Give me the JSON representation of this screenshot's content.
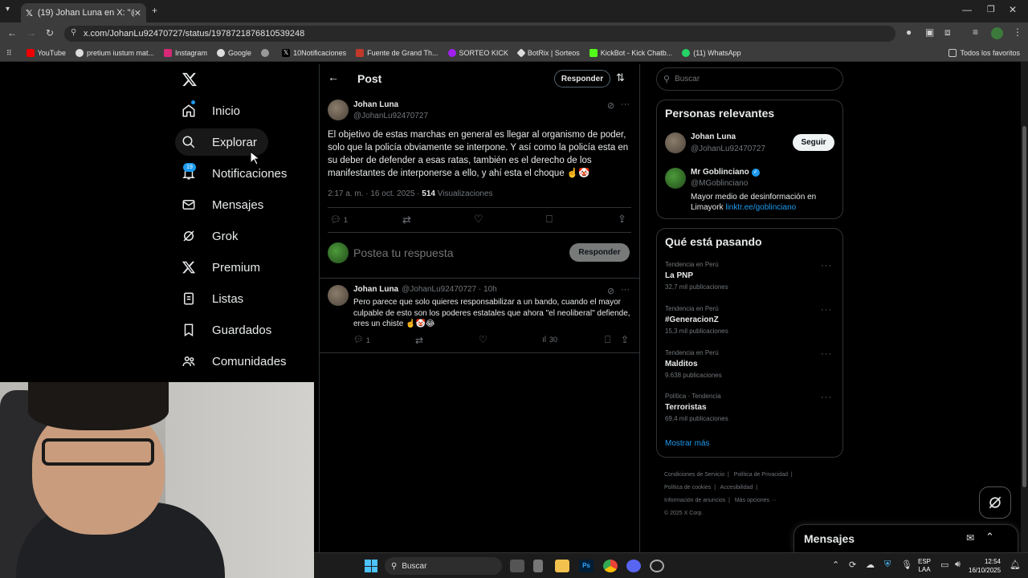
{
  "browser": {
    "tab_title": "(19) Johan Luna en X: \"@MGob",
    "url": "x.com/JohanLu92470727/status/1978721876810539248",
    "bookmarks": [
      "YouTube",
      "pretium iustum mat...",
      "Instagram",
      "Google",
      "",
      "10Notificaciones",
      "Fuente de Grand Th...",
      "SORTEO KICK",
      "BotRix | Sorteos",
      "KickBot - Kick Chatb...",
      "(11) WhatsApp"
    ],
    "all_bookmarks": "Todos los favoritos"
  },
  "nav": {
    "items": [
      {
        "label": "Inicio",
        "icon": "home-icon"
      },
      {
        "label": "Explorar",
        "icon": "search-icon"
      },
      {
        "label": "Notificaciones",
        "icon": "bell-icon",
        "badge": "19"
      },
      {
        "label": "Mensajes",
        "icon": "mail-icon"
      },
      {
        "label": "Grok",
        "icon": "grok-icon"
      },
      {
        "label": "Premium",
        "icon": "x-logo-icon"
      },
      {
        "label": "Listas",
        "icon": "list-icon"
      },
      {
        "label": "Guardados",
        "icon": "bookmark-icon"
      },
      {
        "label": "Comunidades",
        "icon": "communities-icon"
      }
    ]
  },
  "post_header": {
    "title": "Post",
    "reply_btn": "Responder"
  },
  "post": {
    "name": "Johan Luna",
    "handle": "@JohanLu92470727",
    "text": "El objetivo de estas marchas en general es llegar al organismo de poder, solo que la policía obviamente se interpone. Y así como la policía esta en su deber de defender a esas ratas, también es el derecho de los manifestantes de interponerse a ello, y ahí esta el choque ☝️🤡",
    "time": "2:17 a. m. · 16 oct. 2025 · ",
    "views": "514",
    "views_label": "Visualizaciones",
    "replies": "1"
  },
  "composer": {
    "placeholder": "Postea tu respuesta",
    "button": "Responder"
  },
  "reply": {
    "name": "Johan Luna",
    "meta": "@JohanLu92470727 · 10h",
    "text": "Pero parece que solo quieres responsabilizar a un bando, cuando el mayor culpable de esto son los poderes estatales que ahora \"el neoliberal\" defiende, eres un chiste ☝️🤡😂",
    "replies": "1",
    "views": "30"
  },
  "search": {
    "placeholder": "Buscar"
  },
  "relevant": {
    "title": "Personas relevantes",
    "people": [
      {
        "name": "Johan Luna",
        "handle": "@JohanLu92470727",
        "button": "Seguir"
      },
      {
        "name": "Mr Goblinciano",
        "handle": "@MGoblinciano",
        "bio": "Mayor medio de desinformación en Limayork ",
        "link": "linktr.ee/goblinciano"
      }
    ]
  },
  "trends": {
    "title": "Qué está pasando",
    "items": [
      {
        "context": "Tendencia en Perú",
        "name": "La PNP",
        "posts": "32,7 mil publicaciones"
      },
      {
        "context": "Tendencia en Perú",
        "name": "#GeneracionZ",
        "posts": "15,3 mil publicaciones"
      },
      {
        "context": "Tendencia en Perú",
        "name": "Malditos",
        "posts": "9.638 publicaciones"
      },
      {
        "context": "Política · Tendencia",
        "name": "Terroristas",
        "posts": "69,4 mil publicaciones"
      }
    ],
    "show_more": "Mostrar más"
  },
  "footer": {
    "links": [
      "Condiciones de Servicio",
      "|",
      "Política de Privacidad",
      "|",
      "Política de cookies",
      "|",
      "Accesibilidad",
      "|",
      "Información de anuncios",
      "|",
      "Más opciones ···"
    ],
    "copyright": "© 2025 X Corp."
  },
  "messages_drawer": {
    "title": "Mensajes"
  },
  "taskbar": {
    "search": "Buscar",
    "lang1": "ESP",
    "lang2": "LAA",
    "time": "12:54",
    "date": "16/10/2025"
  },
  "colors": {
    "accent": "#1d9bf0",
    "bg": "#000000",
    "border": "#2f3336"
  }
}
